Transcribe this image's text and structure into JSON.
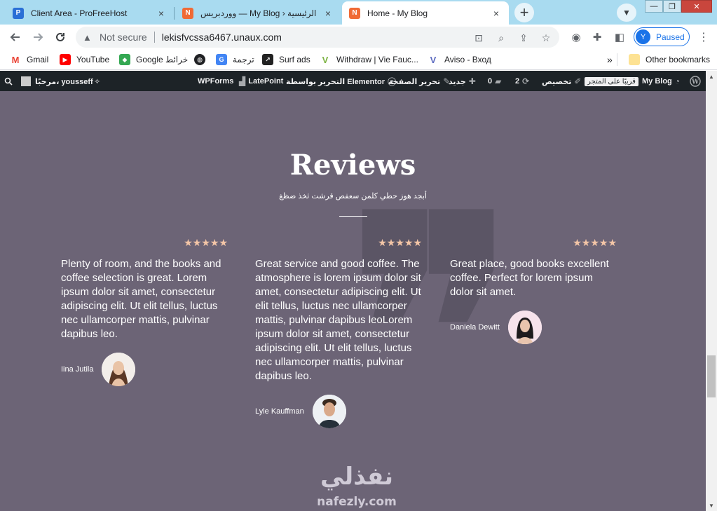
{
  "browser": {
    "tabs": [
      {
        "title": "Client Area - ProFreeHost",
        "favicon": "profreehost-icon",
        "close": "×"
      },
      {
        "title": "الرئيسية ‹ My Blog — ووردبريس",
        "favicon": "nafezly-icon",
        "close": "×"
      },
      {
        "title": "Home - My Blog",
        "favicon": "nafezly-icon",
        "close": "×",
        "active": true
      }
    ],
    "new_tab": "+",
    "window_controls": {
      "minimize": "—",
      "maximize": "❐",
      "close": "✕"
    }
  },
  "toolbar": {
    "security_label": "Not secure",
    "url": "lekisfvcssa6467.unaux.com",
    "profile_initial": "Y",
    "profile_status": "Paused"
  },
  "bookmarks": [
    {
      "label": "Gmail",
      "icon": "gmail-icon",
      "color": "#ea4335"
    },
    {
      "label": "YouTube",
      "icon": "youtube-icon",
      "color": "#ff0000"
    },
    {
      "label": "Google خرائط",
      "icon": "maps-icon",
      "color": "#34a853"
    },
    {
      "label": "",
      "icon": "globe-icon",
      "color": "#202124"
    },
    {
      "label": "ترجمة",
      "icon": "translate-icon",
      "color": "#4285f4"
    },
    {
      "label": "Surf ads",
      "icon": "surfads-icon",
      "color": "#222222"
    },
    {
      "label": "Withdraw | Vie Fauc...",
      "icon": "viefaucet-icon",
      "color": "#7cb342"
    },
    {
      "label": "Aviso - Вход",
      "icon": "aviso-icon",
      "color": "#5c6bc0"
    }
  ],
  "bookmarks_overflow": "»",
  "other_bookmarks": "Other bookmarks",
  "adminbar": {
    "site_name": "My Blog",
    "store_chip": "قريبًا على المتجر",
    "customize": "تخصيص",
    "updates_count": "2",
    "comments_count": "0",
    "new_label": "جديد",
    "edit_page": "تحرير الصفحة",
    "edit_elementor": "التحرير بواسطة Elementor",
    "latepoint": "LatePoint",
    "wpforms": "WPForms",
    "greeting": "مرحبًا، yousseff"
  },
  "reviews": {
    "title": "Reviews",
    "subtitle": "أبجد هوز حطي كلمن سعفص قرشت ثخذ ضظغ",
    "rating_stars": "★★★★★",
    "items": [
      {
        "text": "Plenty of room, and the books and coffee selection is great. Lorem ipsum dolor sit amet, consectetur adipiscing elit. Ut elit tellus, luctus nec ullamcorper mattis, pulvinar dapibus leo.",
        "name": "Iina Jutila"
      },
      {
        "text": "Great service and good coffee. The atmosphere is lorem ipsum dolor sit amet, consectetur adipiscing elit. Ut elit tellus, luctus nec ullamcorper mattis, pulvinar dapibus leoLorem ipsum dolor sit amet, consectetur adipiscing elit. Ut elit tellus, luctus nec ullamcorper mattis, pulvinar dapibus leo.",
        "name": "Lyle Kauffman"
      },
      {
        "text": "Great place, good books excellent coffee. Perfect for lorem ipsum dolor sit amet.",
        "name": "Daniela Dewitt"
      }
    ]
  },
  "watermark": {
    "arabic": "نفذلي",
    "latin": "nafezly.com"
  },
  "colors": {
    "tabstrip": "#a9dbf0",
    "content_bg": "#6c6476",
    "adminbar_bg": "#1d2327",
    "stars": "#f4c6a7"
  }
}
